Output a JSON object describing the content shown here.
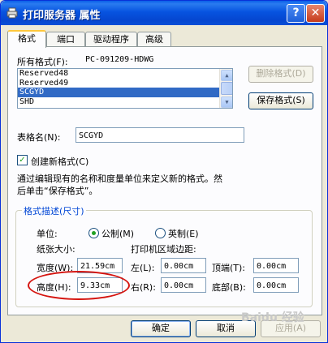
{
  "window": {
    "title": "打印服务器 属性",
    "help_glyph": "?",
    "close_glyph": "✕"
  },
  "tabs": [
    {
      "label": "格式",
      "active": true
    },
    {
      "label": "端口",
      "active": false
    },
    {
      "label": "驱动程序",
      "active": false
    },
    {
      "label": "高级",
      "active": false
    }
  ],
  "formats": {
    "label": "所有格式(F):",
    "server": "PC-091209-HDWG",
    "items": [
      "Reserved48",
      "Reserved49",
      "SCGYD",
      "SHD"
    ],
    "selected": "SCGYD",
    "delete_button": "删除格式(D)",
    "save_button": "保存格式(S)"
  },
  "form_name": {
    "label": "表格名(N):",
    "value": "SCGYD"
  },
  "create_new": {
    "label": "创建新格式(C)",
    "checked": true
  },
  "description": {
    "line1": "通过编辑现有的名称和度量单位来定义新的格式。然",
    "line2": "后单击“保存格式”。"
  },
  "group": {
    "title": "格式描述(尺寸)",
    "unit_label": "单位:",
    "metric_label": "公制(M)",
    "english_label": "英制(E)",
    "unit_selected": "metric",
    "paper_size_label": "纸张大小:",
    "margins_label": "打印机区域边距:",
    "width_label": "宽度(W):",
    "width_value": "21.59cm",
    "height_label": "高度(H):",
    "height_value": "9.33cm",
    "left_label": "左(L):",
    "left_value": "0.00cm",
    "right_label": "右(R):",
    "right_value": "0.00cm",
    "top_label": "顶端(T):",
    "top_value": "0.00cm",
    "bottom_label": "底部(B):",
    "bottom_value": "0.00cm"
  },
  "footer": {
    "ok": "确定",
    "cancel": "取消",
    "apply": "应用(A)"
  },
  "watermark": "Baidu 经验",
  "colors": {
    "titlebar": "#0754e0",
    "selection": "#316ac5",
    "group_title": "#0046d5",
    "annotation": "#d5140f"
  }
}
